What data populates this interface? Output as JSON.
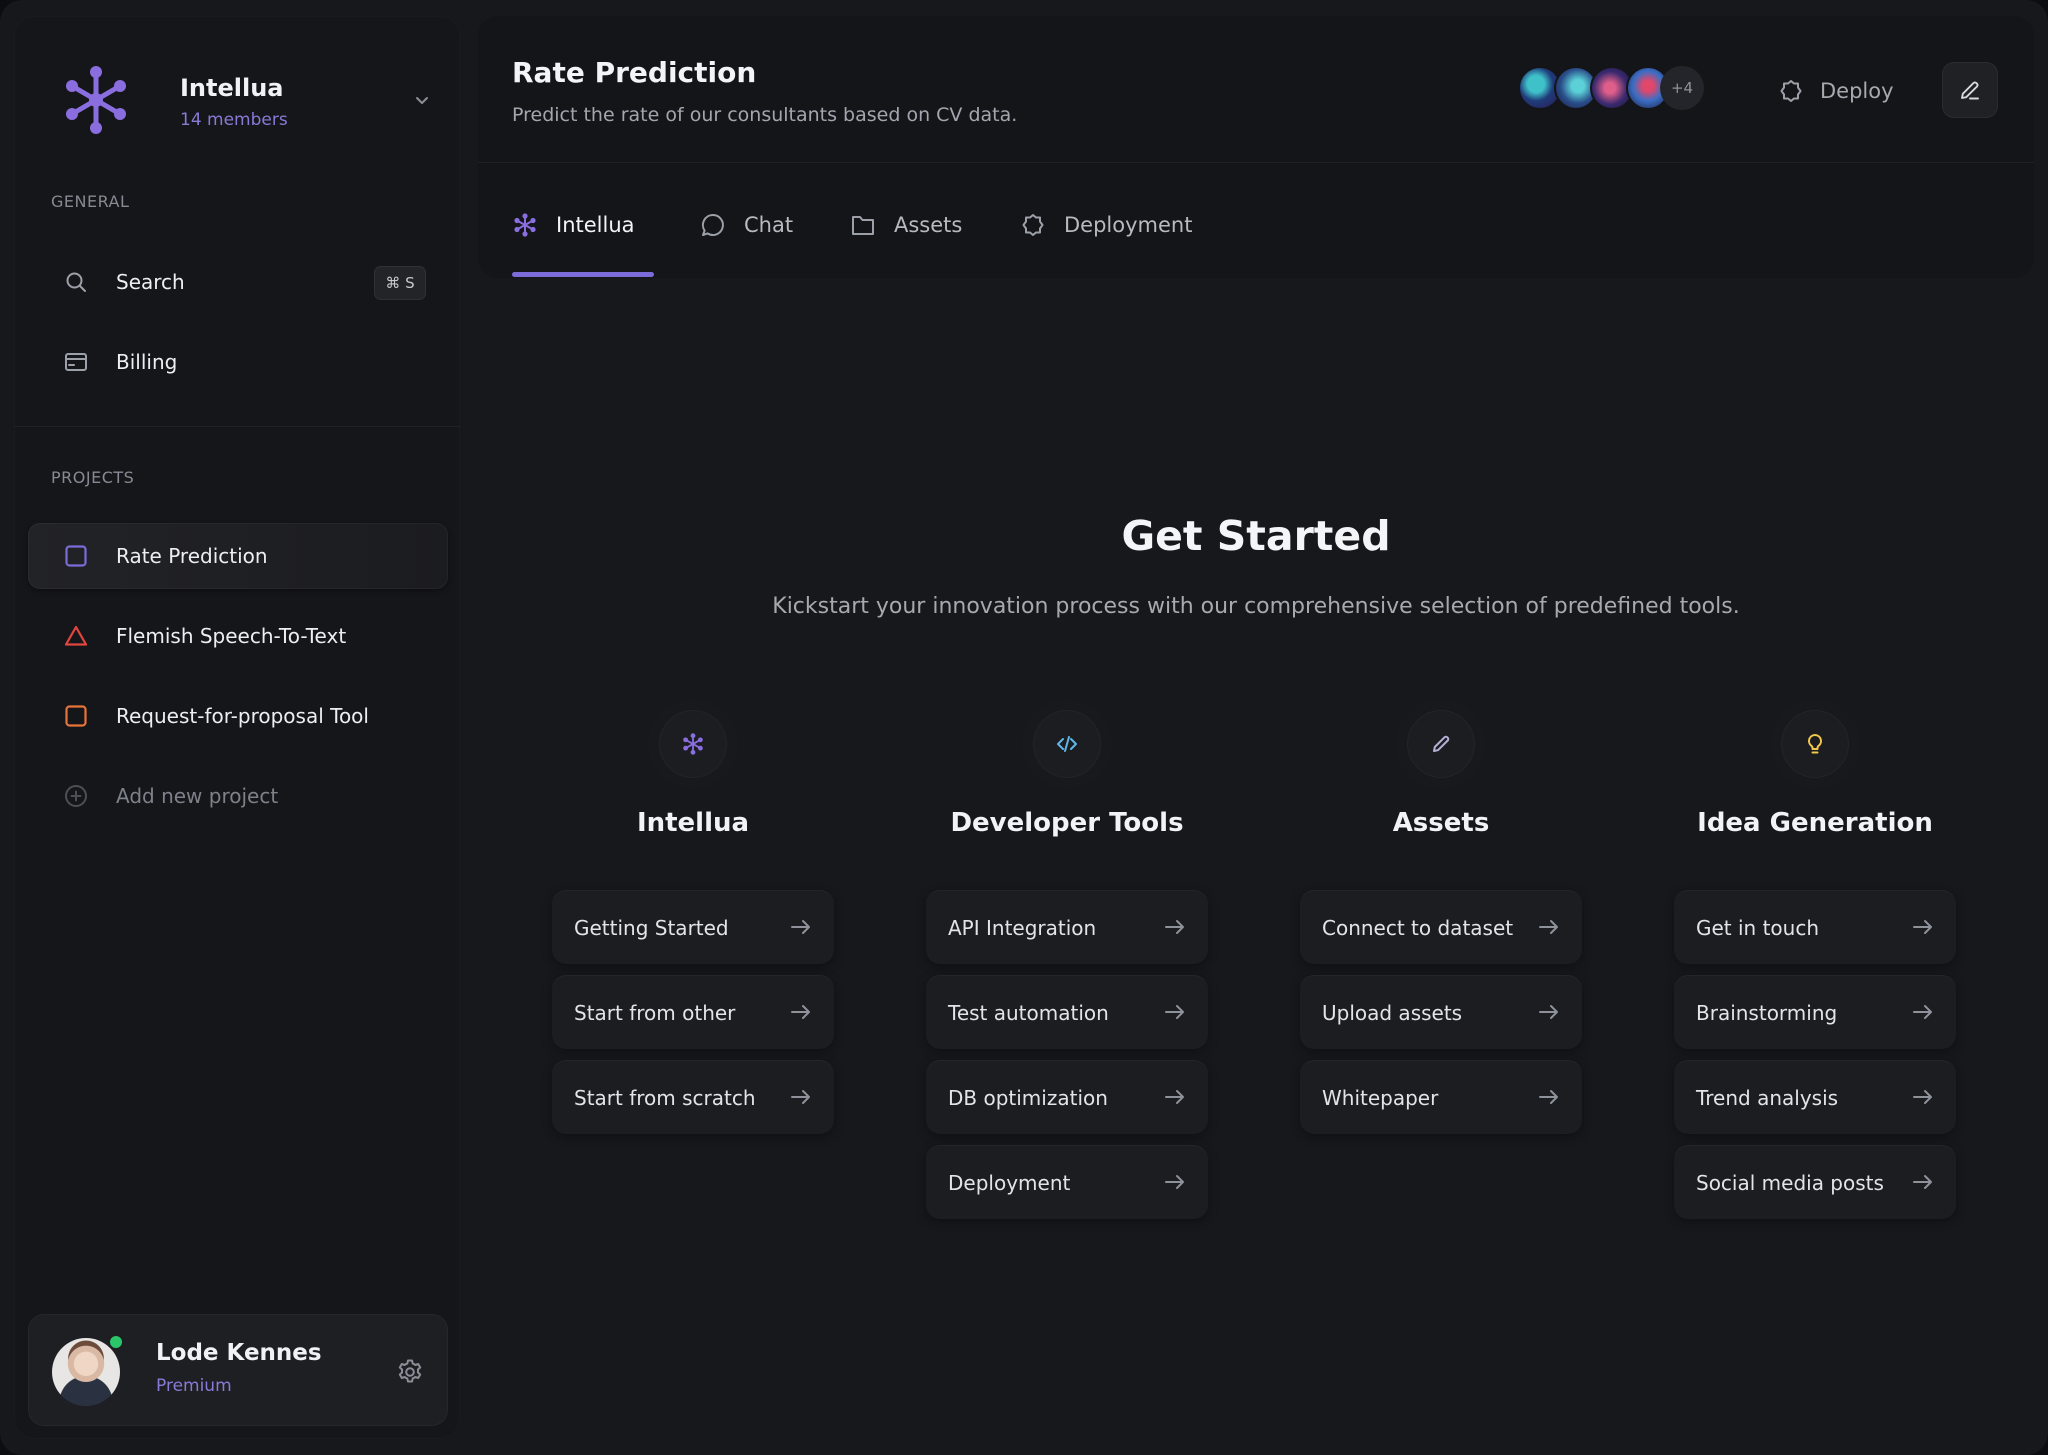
{
  "workspace": {
    "name": "Intellua",
    "members": "14 members"
  },
  "sidebar": {
    "general_label": "GENERAL",
    "search": {
      "label": "Search",
      "shortcut": "⌘ S"
    },
    "billing": {
      "label": "Billing"
    },
    "projects_label": "PROJECTS",
    "projects": [
      {
        "label": "Rate Prediction",
        "color": "#7b6cd9",
        "icon": "square-icon"
      },
      {
        "label": "Flemish Speech-To-Text",
        "color": "#e0453f",
        "icon": "triangle-icon"
      },
      {
        "label": "Request-for-proposal Tool",
        "color": "#e8743a",
        "icon": "square-icon"
      }
    ],
    "add_project": "Add new project"
  },
  "user": {
    "name": "Lode Kennes",
    "plan": "Premium"
  },
  "header": {
    "title": "Rate Prediction",
    "subtitle": "Predict the rate of our consultants based on CV data.",
    "avatars_more": "+4",
    "deploy_label": "Deploy"
  },
  "tabs": [
    {
      "label": "Intellua",
      "icon": "asterisk-icon",
      "active": true
    },
    {
      "label": "Chat",
      "icon": "chat-bubble-icon"
    },
    {
      "label": "Assets",
      "icon": "folder-icon"
    },
    {
      "label": "Deployment",
      "icon": "deploy-icon"
    }
  ],
  "hero": {
    "title": "Get Started",
    "subtitle": "Kickstart your innovation process with our comprehensive selection of predefined tools."
  },
  "columns": [
    {
      "title": "Intellua",
      "icon": "asterisk-icon",
      "items": [
        "Getting Started",
        "Start from other",
        "Start from scratch"
      ]
    },
    {
      "title": "Developer Tools",
      "icon": "code-icon",
      "items": [
        "API Integration",
        "Test automation",
        "DB optimization",
        "Deployment"
      ]
    },
    {
      "title": "Assets",
      "icon": "pencil-icon",
      "items": [
        "Connect to dataset",
        "Upload assets",
        "Whitepaper"
      ]
    },
    {
      "title": "Idea Generation",
      "icon": "lightbulb-icon",
      "items": [
        "Get in touch",
        "Brainstorming",
        "Trend analysis",
        "Social media posts"
      ]
    }
  ],
  "colors": {
    "accent": "#7b6cd9",
    "background": "#17181b",
    "online": "#2cc66a",
    "bulb": "#f2c94c",
    "code": "#5fb8e6"
  }
}
